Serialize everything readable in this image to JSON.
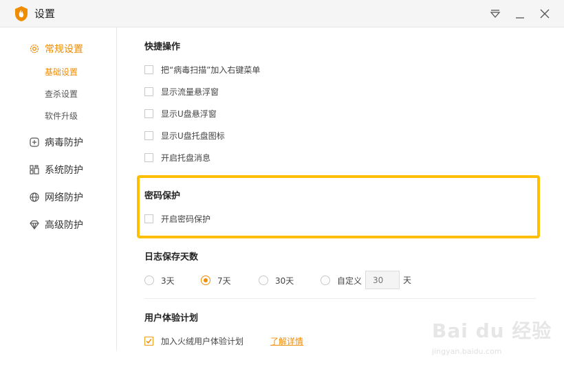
{
  "window": {
    "title": "设置"
  },
  "sidebar": {
    "items": [
      {
        "label": "常规设置",
        "icon": "gear-icon",
        "active": true
      },
      {
        "label": "病毒防护",
        "icon": "plus-square-icon"
      },
      {
        "label": "系统防护",
        "icon": "grid-icon"
      },
      {
        "label": "网络防护",
        "icon": "globe-icon"
      },
      {
        "label": "高级防护",
        "icon": "diamond-icon"
      }
    ],
    "sub_items": [
      {
        "label": "基础设置",
        "active": true
      },
      {
        "label": "查杀设置"
      },
      {
        "label": "软件升级"
      }
    ]
  },
  "main": {
    "quick_ops": {
      "title": "快捷操作",
      "options": [
        {
          "label": "把“病毒扫描”加入右键菜单",
          "checked": false
        },
        {
          "label": "显示流量悬浮窗",
          "checked": false
        },
        {
          "label": "显示U盘悬浮窗",
          "checked": false
        },
        {
          "label": "显示U盘托盘图标",
          "checked": false
        },
        {
          "label": "开启托盘消息",
          "checked": false
        }
      ]
    },
    "password": {
      "title": "密码保护",
      "option": {
        "label": "开启密码保护",
        "checked": false
      }
    },
    "log_days": {
      "title": "日志保存天数",
      "options": [
        "3天",
        "7天",
        "30天",
        "自定义"
      ],
      "selected": "7天",
      "custom_placeholder": "30",
      "unit": "天"
    },
    "ux_plan": {
      "title": "用户体验计划",
      "option": {
        "label": "加入火绒用户体验计划",
        "checked": true
      },
      "link": "了解详情"
    }
  },
  "watermark": {
    "main": "Bai du 经验",
    "sub": "jingyan.baidu.com"
  },
  "colors": {
    "accent": "#f08c00",
    "highlight": "#ffbf00"
  }
}
